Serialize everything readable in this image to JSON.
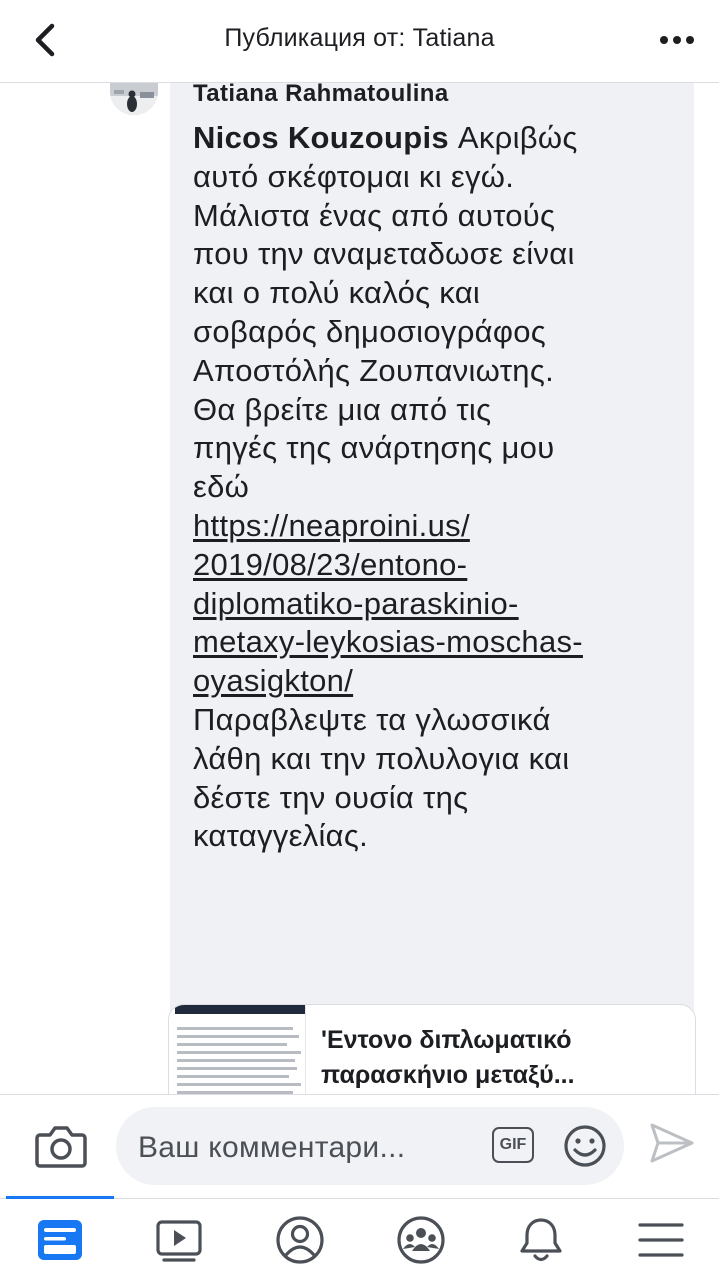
{
  "header": {
    "title": "Публикация от: Tatiana",
    "back_icon": "chevron-left-icon",
    "more_icon": "more-horizontal-icon"
  },
  "comment": {
    "author": "Tatiana Rahmatoulina",
    "mention": "Nicos Kouzoupis",
    "lines": [
      " Ακριβώς",
      "αυτό σκέφτομαι κι εγώ.",
      "Μάλιστα ένας από αυτούς",
      "που την αναμεταδωσε είναι",
      "και ο πολύ καλός και",
      "σοβαρός δημοσιογράφος",
      "Αποστόλής Ζουπανιωτης.",
      "Θα βρείτε μια από τις",
      "πηγές της ανάρτησης μου",
      "εδώ"
    ],
    "link_lines": [
      "https://neaproini.us/",
      "2019/08/23/entono-",
      "diplomatiko-paraskinio-",
      "metaxy-leykosias-moschas-",
      "oyasigkton/"
    ],
    "after_lines": [
      "Παραβλεψτε τα  γλωσσικά",
      "λάθη και την πολυλογια και",
      "δέστε την ουσία της",
      "καταγγελίας."
    ]
  },
  "link_preview": {
    "title_line1": "'Εντονο διπλωματικό",
    "title_line2": "παρασκήνιο μεταξύ..."
  },
  "composer": {
    "placeholder": "Ваш комментари...",
    "gif_label": "GIF",
    "camera_icon": "camera-icon",
    "emoji_icon": "smiley-icon",
    "send_icon": "send-icon"
  },
  "tabs": [
    {
      "name": "news-feed",
      "icon": "news-feed-icon",
      "active": true
    },
    {
      "name": "watch",
      "icon": "video-play-icon",
      "active": false
    },
    {
      "name": "profile",
      "icon": "profile-icon",
      "active": false
    },
    {
      "name": "groups",
      "icon": "groups-icon",
      "active": false
    },
    {
      "name": "notifications",
      "icon": "bell-icon",
      "active": false
    },
    {
      "name": "menu",
      "icon": "hamburger-menu-icon",
      "active": false
    }
  ],
  "colors": {
    "accent": "#1877f2",
    "bubble": "#eff1f4",
    "icon": "#4b4f56"
  }
}
